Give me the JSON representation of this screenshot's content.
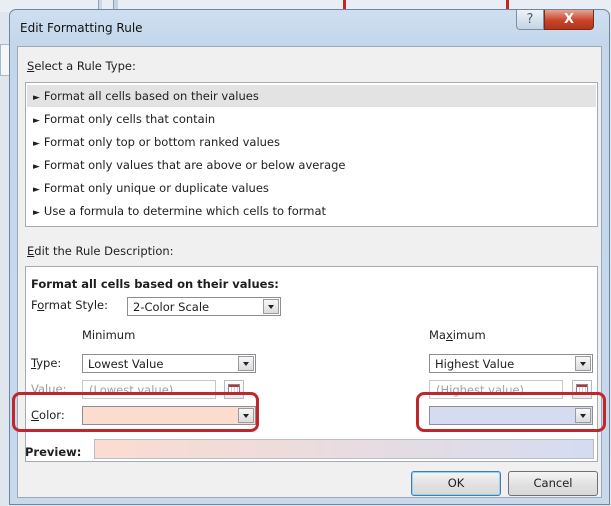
{
  "window": {
    "title": "Edit Formatting Rule",
    "help_glyph": "?",
    "close_glyph": "X"
  },
  "rule_type": {
    "label_accel": "S",
    "label_rest": "elect a Rule Type:",
    "items": [
      {
        "label": "Format all cells based on their values",
        "selected": true
      },
      {
        "label": "Format only cells that contain",
        "selected": false
      },
      {
        "label": "Format only top or bottom ranked values",
        "selected": false
      },
      {
        "label": "Format only values that are above or below average",
        "selected": false
      },
      {
        "label": "Format only unique or duplicate values",
        "selected": false
      },
      {
        "label": "Use a formula to determine which cells to format",
        "selected": false
      }
    ],
    "arrow_glyph": "►"
  },
  "description": {
    "label_accel": "E",
    "label_rest": "dit the Rule Description:",
    "heading": "Format all cells based on their values:",
    "format_style": {
      "label_pre": "F",
      "label_accel": "o",
      "label_rest": "rmat Style:",
      "value": "2-Color Scale"
    },
    "minimum": {
      "heading": "Minimum",
      "type_label_accel": "T",
      "type_label_rest": "ype:",
      "type_value": "Lowest Value",
      "value_label_accel": "V",
      "value_label_rest": "alue:",
      "value_placeholder": "(Lowest value)",
      "color_label_accel": "C",
      "color_label_rest": "olor:",
      "color": "#fcdccf"
    },
    "maximum": {
      "heading_pre": "Ma",
      "heading_accel": "x",
      "heading_rest": "imum",
      "type_value": "Highest Value",
      "value_placeholder": "(Highest value)",
      "color": "#d5dcf1"
    },
    "preview": {
      "label": "Preview:",
      "gradient_from": "#fcdccf",
      "gradient_to": "#d5dcf1"
    }
  },
  "buttons": {
    "ok": "OK",
    "cancel": "Cancel"
  },
  "colors": {
    "annotation_red": "#c0272d",
    "selection_gray": "#e3e3e3"
  }
}
